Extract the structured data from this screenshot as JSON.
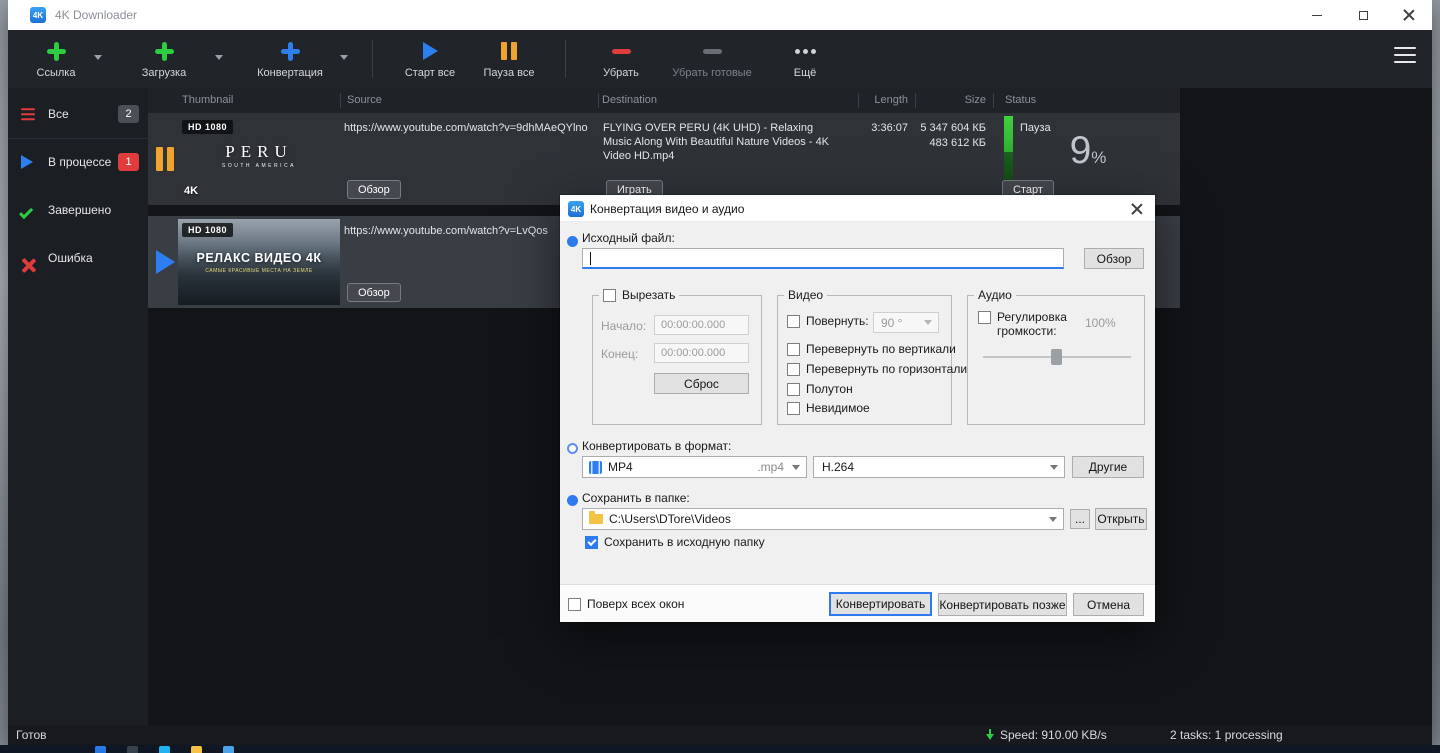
{
  "window": {
    "title": "4K Downloader",
    "app_icon": "4K"
  },
  "toolbar": {
    "link": "Ссылка",
    "download": "Загрузка",
    "convert": "Конвертация",
    "start_all": "Старт все",
    "pause_all": "Пауза все",
    "remove": "Убрать",
    "remove_finished": "Убрать готовые",
    "more": "Ещё"
  },
  "sidebar": {
    "items": [
      {
        "label": "Все",
        "badge": "2"
      },
      {
        "label": "В процессе",
        "badge": "1"
      },
      {
        "label": "Завершено"
      },
      {
        "label": "Ошибка"
      }
    ]
  },
  "table": {
    "headers": [
      "Thumbnail",
      "Source",
      "Destination",
      "Length",
      "Size",
      "Status"
    ],
    "rows": [
      {
        "quality_badge": "HD 1080",
        "thumb_title": "PERU",
        "thumb_subtitle": "SOUTH AMERICA",
        "thumb_logo": "4K",
        "source_url": "https://www.youtube.com/watch?v=9dhMAeQYlno",
        "browse_button": "Обзор",
        "destination": "FLYING OVER PERU (4K UHD) - Relaxing Music Along With Beautiful Nature Videos - 4K Video HD.mp4",
        "play_button": "Играть",
        "length": "3:36:07",
        "size_total": "5 347 604 КБ",
        "size_downloaded": "483 612 КБ",
        "status": "Пауза",
        "progress_percent": "9",
        "percent_sign": "%",
        "start_button": "Старт"
      },
      {
        "quality_badge": "HD 1080",
        "thumb_title": "РЕЛАКС ВИДЕО 4К",
        "thumb_subtitle": "САМЫЕ КРАСИВЫЕ МЕСТА НА ЗЕМЛЕ",
        "source_url": "https://www.youtube.com/watch?v=LvQos",
        "browse_button": "Обзор"
      }
    ]
  },
  "dialog": {
    "title": "Конвертация видео и аудио",
    "source_file": {
      "label": "Исходный файл:",
      "browse_button": "Обзор"
    },
    "cut": {
      "label": "Вырезать",
      "start_label": "Начало:",
      "start_value": "00:00:00.000",
      "end_label": "Конец:",
      "end_value": "00:00:00.000",
      "reset_button": "Сброс"
    },
    "video": {
      "label": "Видео",
      "rotate_label": "Повернуть:",
      "rotate_value": "90 °",
      "flip_vertical": "Перевернуть по вертикали",
      "flip_horizontal": "Перевернуть по горизонтали",
      "halftone": "Полутон",
      "invisible": "Невидимое"
    },
    "audio": {
      "label": "Аудио",
      "volume_label": "Регулировка громкости:",
      "volume_value": "100%"
    },
    "format": {
      "label": "Конвертировать в формат:",
      "container": "MP4",
      "extension": ".mp4",
      "codec": "H.264",
      "others_button": "Другие"
    },
    "save": {
      "label": "Сохранить в папке:",
      "path": "C:\\Users\\DTore\\Videos",
      "more_button": "...",
      "open_button": "Открыть",
      "keep_source_folder": "Сохранить в исходную папку"
    },
    "footer": {
      "always_on_top": "Поверх всех окон",
      "convert_button": "Конвертировать",
      "convert_later_button": "Конвертировать позже",
      "cancel_button": "Отмена"
    }
  },
  "statusbar": {
    "ready": "Готов",
    "speed": "Speed: 910.00 KB/s",
    "tasks": "2 tasks: 1 processing"
  }
}
